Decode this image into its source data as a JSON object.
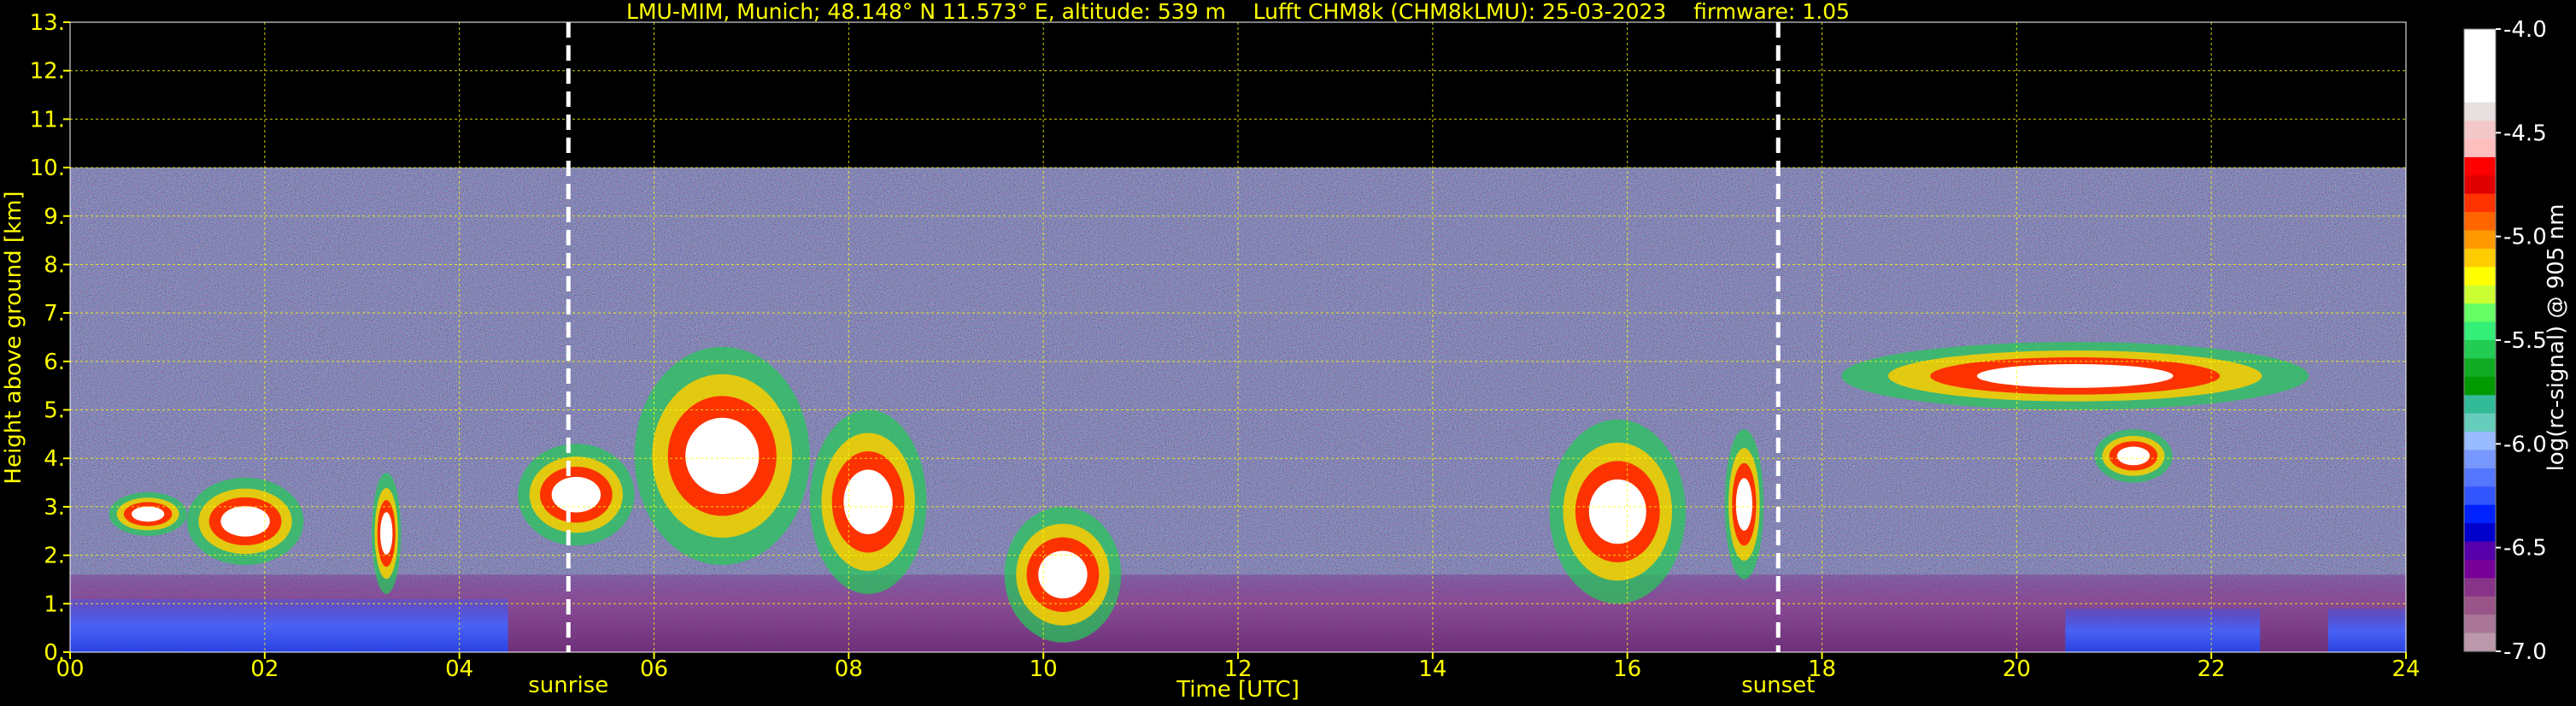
{
  "chart_data": {
    "type": "heatmap",
    "title": "LMU-MIM, Munich; 48.148° N 11.573° E, altitude: 539 m    Lufft CHM8k (CHM8kLMU): 25-03-2023    firmware: 1.05",
    "xlabel": "Time [UTC]",
    "ylabel": "Height above ground [km]",
    "xlim": [
      0,
      24
    ],
    "ylim": [
      0,
      13
    ],
    "x_ticks": [
      "00",
      "02",
      "04",
      "06",
      "08",
      "10",
      "12",
      "14",
      "16",
      "18",
      "20",
      "22",
      "24"
    ],
    "y_ticks": [
      "0.",
      "1.",
      "2.",
      "3.",
      "4.",
      "5.",
      "6.",
      "7.",
      "8.",
      "9.",
      "10.",
      "11.",
      "12.",
      "13."
    ],
    "grid": true,
    "data_top_km": 10,
    "events": [
      {
        "label": "sunrise",
        "time": 5.12
      },
      {
        "label": "sunset",
        "time": 17.55
      }
    ],
    "colorbar": {
      "label": "log(rc-signal) @ 905 nm",
      "range": [
        -7.0,
        -4.0
      ],
      "ticks": [
        "-4.0",
        "-4.5",
        "-5.0",
        "-5.5",
        "-6.0",
        "-6.5",
        "-7.0"
      ],
      "tick_values": [
        -4.0,
        -4.5,
        -5.0,
        -5.5,
        -6.0,
        -6.5,
        -7.0
      ],
      "colors_top_to_bottom": [
        "#ffffff",
        "#ffffff",
        "#ffffff",
        "#ffffff",
        "#e8e0e0",
        "#f4c8c8",
        "#ffbfbf",
        "#ff0000",
        "#e00000",
        "#ff3300",
        "#ff6600",
        "#ff9900",
        "#ffcc00",
        "#ffff00",
        "#ccff33",
        "#66ff66",
        "#33ee77",
        "#22cc55",
        "#11aa22",
        "#009900",
        "#33bb99",
        "#66ccbb",
        "#99bbff",
        "#7799ff",
        "#5577ff",
        "#3355ff",
        "#0022ff",
        "#0000cc",
        "#5500aa",
        "#770099",
        "#883388",
        "#995588",
        "#aa7799",
        "#bb99aa"
      ]
    },
    "features": [
      {
        "name": "boundary layer",
        "time_range": [
          0,
          24
        ],
        "height_km": [
          0,
          1.6
        ]
      },
      {
        "name": "cloud patch",
        "time_range": [
          0.4,
          1.2
        ],
        "height_km": [
          2.4,
          3.3
        ]
      },
      {
        "name": "cloud patch",
        "time_range": [
          1.2,
          2.4
        ],
        "height_km": [
          1.8,
          3.6
        ]
      },
      {
        "name": "cloud patch",
        "time_range": [
          3.1,
          3.4
        ],
        "height_km": [
          1.2,
          3.7
        ]
      },
      {
        "name": "cloud patch",
        "time_range": [
          4.6,
          5.8
        ],
        "height_km": [
          2.2,
          4.3
        ]
      },
      {
        "name": "cloud patch",
        "time_range": [
          5.8,
          7.6
        ],
        "height_km": [
          1.8,
          6.3
        ]
      },
      {
        "name": "cloud patch",
        "time_range": [
          7.6,
          8.8
        ],
        "height_km": [
          1.2,
          5.0
        ]
      },
      {
        "name": "cloud patch",
        "time_range": [
          9.6,
          10.8
        ],
        "height_km": [
          0.2,
          3.0
        ]
      },
      {
        "name": "cloud patch",
        "time_range": [
          15.2,
          16.6
        ],
        "height_km": [
          1.0,
          4.8
        ]
      },
      {
        "name": "cloud patch",
        "time_range": [
          17.0,
          17.4
        ],
        "height_km": [
          1.5,
          4.6
        ]
      },
      {
        "name": "cloud patch",
        "time_range": [
          18.2,
          23.0
        ],
        "height_km": [
          5.0,
          6.4
        ]
      },
      {
        "name": "cloud patch",
        "time_range": [
          20.8,
          21.6
        ],
        "height_km": [
          3.5,
          4.6
        ]
      }
    ]
  }
}
